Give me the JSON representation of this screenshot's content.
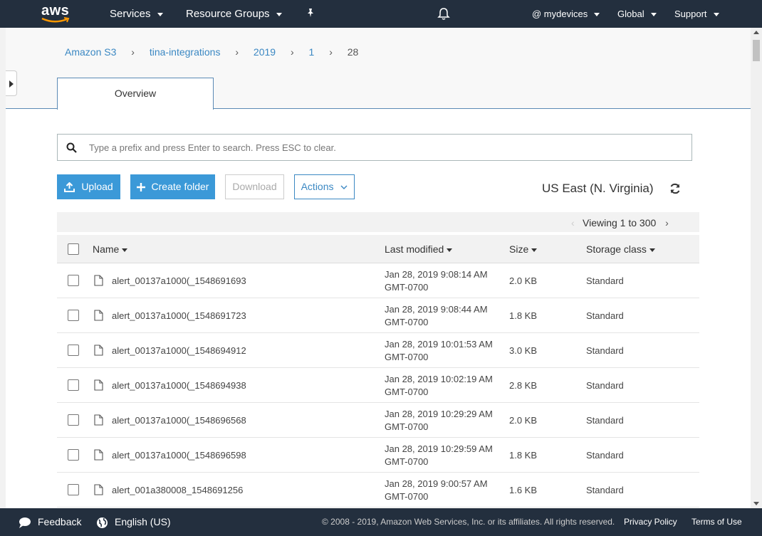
{
  "colors": {
    "nav_bg": "#232f3e",
    "accent_blue": "#3b99d8",
    "link_blue": "#3b88c3",
    "aws_orange": "#ff9900"
  },
  "nav": {
    "logo_text": "aws",
    "services": "Services",
    "resource_groups": "Resource Groups",
    "pin_icon": "pin-icon",
    "bell_icon": "bell-icon",
    "account": "@ mydevices",
    "region_menu": "Global",
    "support": "Support"
  },
  "breadcrumb": [
    {
      "label": "Amazon S3"
    },
    {
      "label": "tina-integrations"
    },
    {
      "label": "2019"
    },
    {
      "label": "1"
    },
    {
      "label": "28"
    }
  ],
  "tabs": [
    {
      "label": "Overview"
    }
  ],
  "search": {
    "placeholder": "Type a prefix and press Enter to search. Press ESC to clear.",
    "value": ""
  },
  "toolbar": {
    "upload": "Upload",
    "create_folder": "Create folder",
    "download": "Download",
    "actions": "Actions",
    "region": "US East (N. Virginia)"
  },
  "pagination": {
    "viewing": "Viewing 1 to 300"
  },
  "table": {
    "columns": {
      "name": "Name",
      "last_modified": "Last modified",
      "size": "Size",
      "storage_class": "Storage class"
    },
    "rows": [
      {
        "name": "alert_00137a1000(_1548691693",
        "modified_date": "Jan 28, 2019 9:08:14 AM",
        "modified_tz": "GMT-0700",
        "size": "2.0 KB",
        "storage_class": "Standard"
      },
      {
        "name": "alert_00137a1000(_1548691723",
        "modified_date": "Jan 28, 2019 9:08:44 AM",
        "modified_tz": "GMT-0700",
        "size": "1.8 KB",
        "storage_class": "Standard"
      },
      {
        "name": "alert_00137a1000(_1548694912",
        "modified_date": "Jan 28, 2019 10:01:53 AM",
        "modified_tz": "GMT-0700",
        "size": "3.0 KB",
        "storage_class": "Standard"
      },
      {
        "name": "alert_00137a1000(_1548694938",
        "modified_date": "Jan 28, 2019 10:02:19 AM",
        "modified_tz": "GMT-0700",
        "size": "2.8 KB",
        "storage_class": "Standard"
      },
      {
        "name": "alert_00137a1000(_1548696568",
        "modified_date": "Jan 28, 2019 10:29:29 AM",
        "modified_tz": "GMT-0700",
        "size": "2.0 KB",
        "storage_class": "Standard"
      },
      {
        "name": "alert_00137a1000(_1548696598",
        "modified_date": "Jan 28, 2019 10:29:59 AM",
        "modified_tz": "GMT-0700",
        "size": "1.8 KB",
        "storage_class": "Standard"
      },
      {
        "name": "alert_001a380008_1548691256",
        "modified_date": "Jan 28, 2019 9:00:57 AM",
        "modified_tz": "GMT-0700",
        "size": "1.6 KB",
        "storage_class": "Standard"
      }
    ]
  },
  "footer": {
    "feedback": "Feedback",
    "language": "English (US)",
    "copyright": "© 2008 - 2019, Amazon Web Services, Inc. or its affiliates. All rights reserved.",
    "privacy": "Privacy Policy",
    "terms": "Terms of Use"
  }
}
